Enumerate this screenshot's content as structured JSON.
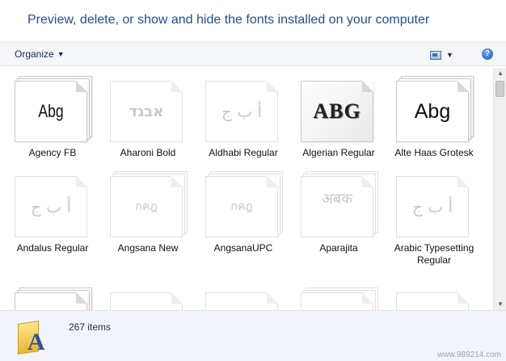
{
  "header": {
    "title": "Preview, delete, or show and hide the fonts installed on your computer"
  },
  "toolbar": {
    "organize_label": "Organize",
    "help_label": "?"
  },
  "fonts": [
    {
      "name": "Agency FB",
      "sample": "Abg"
    },
    {
      "name": "Aharoni Bold",
      "sample": "אבגד"
    },
    {
      "name": "Aldhabi Regular",
      "sample": "أ ب ج"
    },
    {
      "name": "Algerian Regular",
      "sample": "ABG"
    },
    {
      "name": "Alte Haas Grotesk",
      "sample": "Abg"
    },
    {
      "name": "Andalus Regular",
      "sample": "أ ب ج"
    },
    {
      "name": "Angsana New",
      "sample": "กคฎ"
    },
    {
      "name": "AngsanaUPC",
      "sample": "กคฎ"
    },
    {
      "name": "Aparajita",
      "sample": "अबक"
    },
    {
      "name": "Arabic Typesetting Regular",
      "sample": "أ ب ج"
    }
  ],
  "status": {
    "item_count": "267 items"
  },
  "watermark": "www.989214.com"
}
